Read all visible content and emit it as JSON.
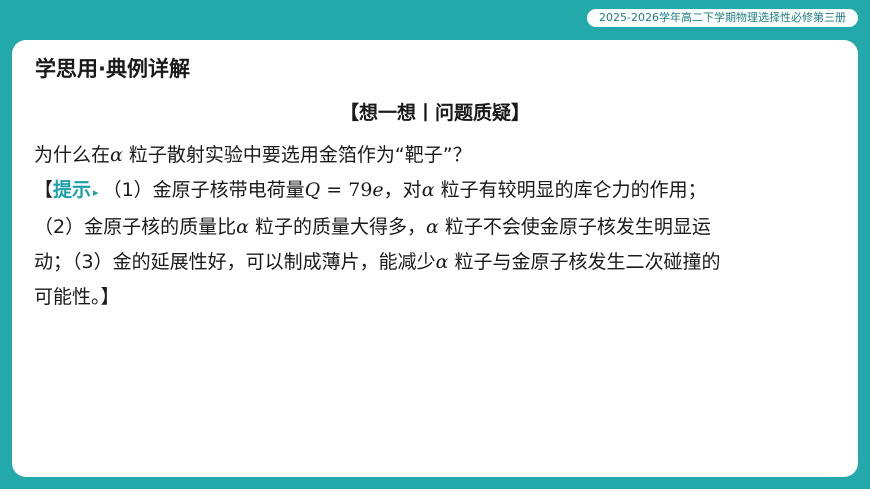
{
  "header": {
    "series": "2025-2026学年高二下学期物理选择性必修第三册"
  },
  "content": {
    "section_title": "学思用·典例详解",
    "heading": "【想一想丨问题质疑】",
    "question": {
      "text_before": "为什么在",
      "greek": "α",
      "text_after": " 粒子散射实验中要选用金箔作为“靶子”？"
    },
    "hint": {
      "open_bracket": "【",
      "label": "提示",
      "arrow": "▸",
      "line1_part1": "（1）金原子核带电荷量",
      "formula_var": "Q",
      "formula_rest": " = 79",
      "formula_unit": "e",
      "line1_part2": "，对",
      "line1_greek": "α",
      "line1_part3": " 粒子有较明显的库仑力的作用；",
      "line2_part1": "（2）金原子核的质量比",
      "line2_greek1": "α",
      "line2_part2": " 粒子的质量大得多，",
      "line2_greek2": "α",
      "line2_part3": " 粒子不会使金原子核发生明显运",
      "line3_part1": "动；（3）金的延展性好，可以制成薄片，能减少",
      "line3_greek": "α",
      "line3_part2": " 粒子与金原子核发生二次碰撞的",
      "line4": "可能性。】"
    }
  }
}
